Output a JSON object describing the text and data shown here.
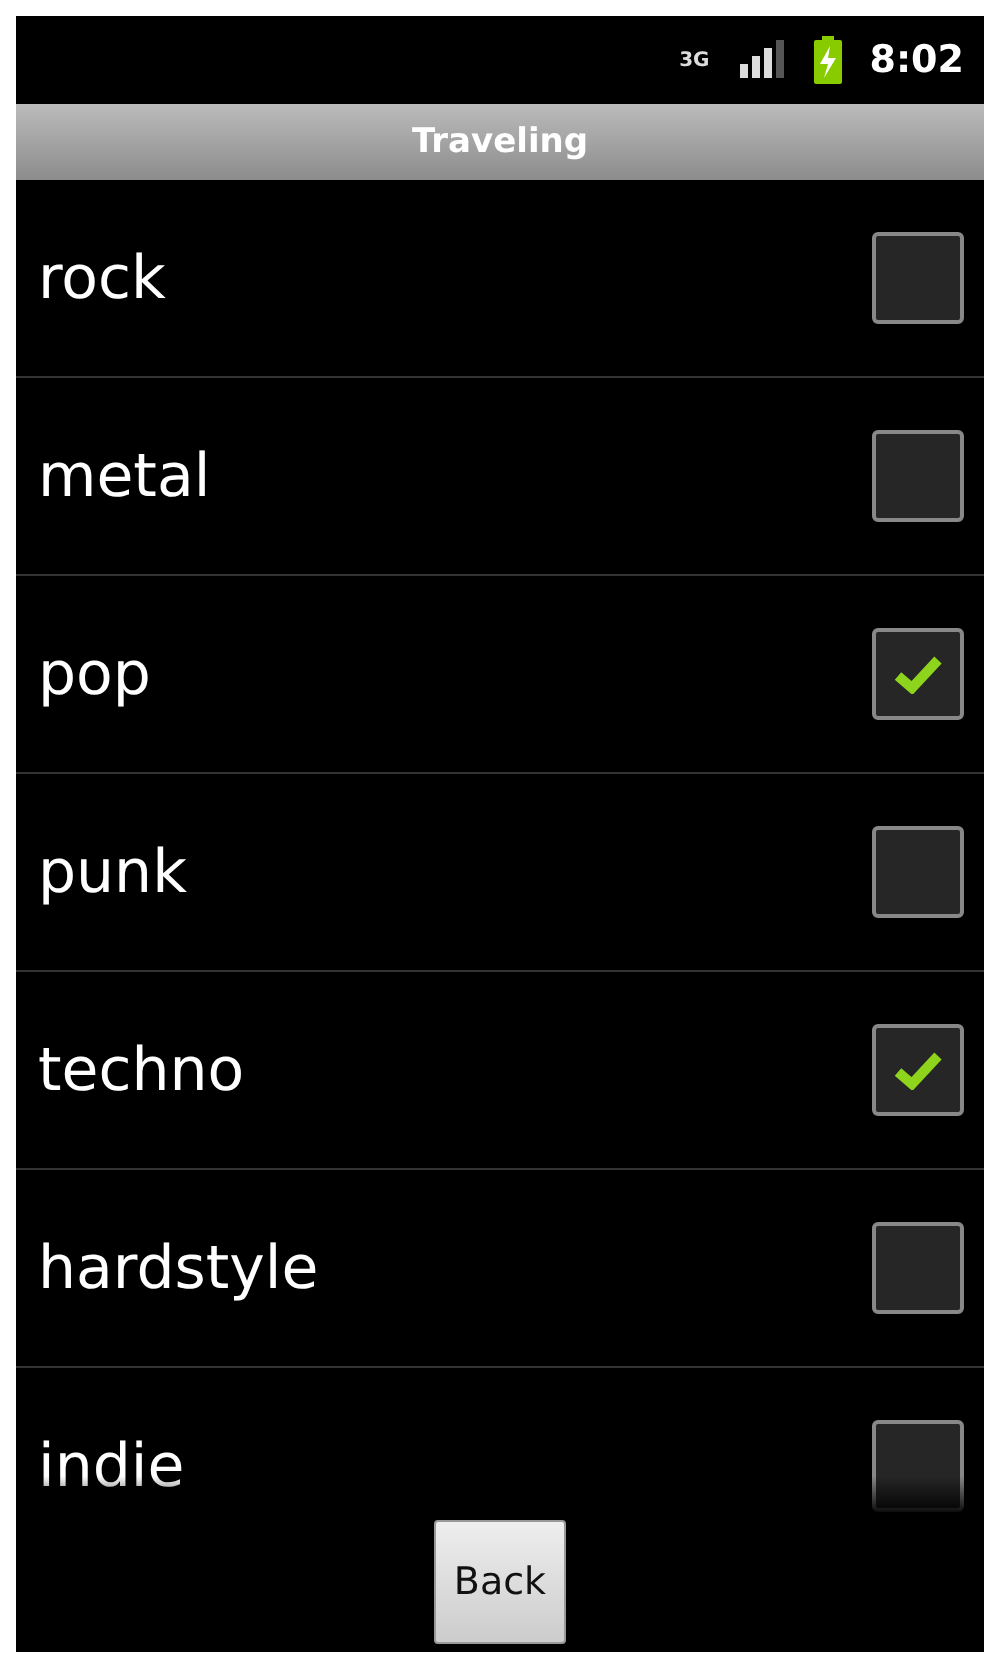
{
  "status_bar": {
    "network": "3G",
    "time": "8:02"
  },
  "title": "Traveling",
  "items": [
    {
      "label": "rock",
      "checked": false
    },
    {
      "label": "metal",
      "checked": false
    },
    {
      "label": "pop",
      "checked": true
    },
    {
      "label": "punk",
      "checked": false
    },
    {
      "label": "techno",
      "checked": true
    },
    {
      "label": "hardstyle",
      "checked": false
    },
    {
      "label": "indie",
      "checked": false
    }
  ],
  "back_button": "Back"
}
